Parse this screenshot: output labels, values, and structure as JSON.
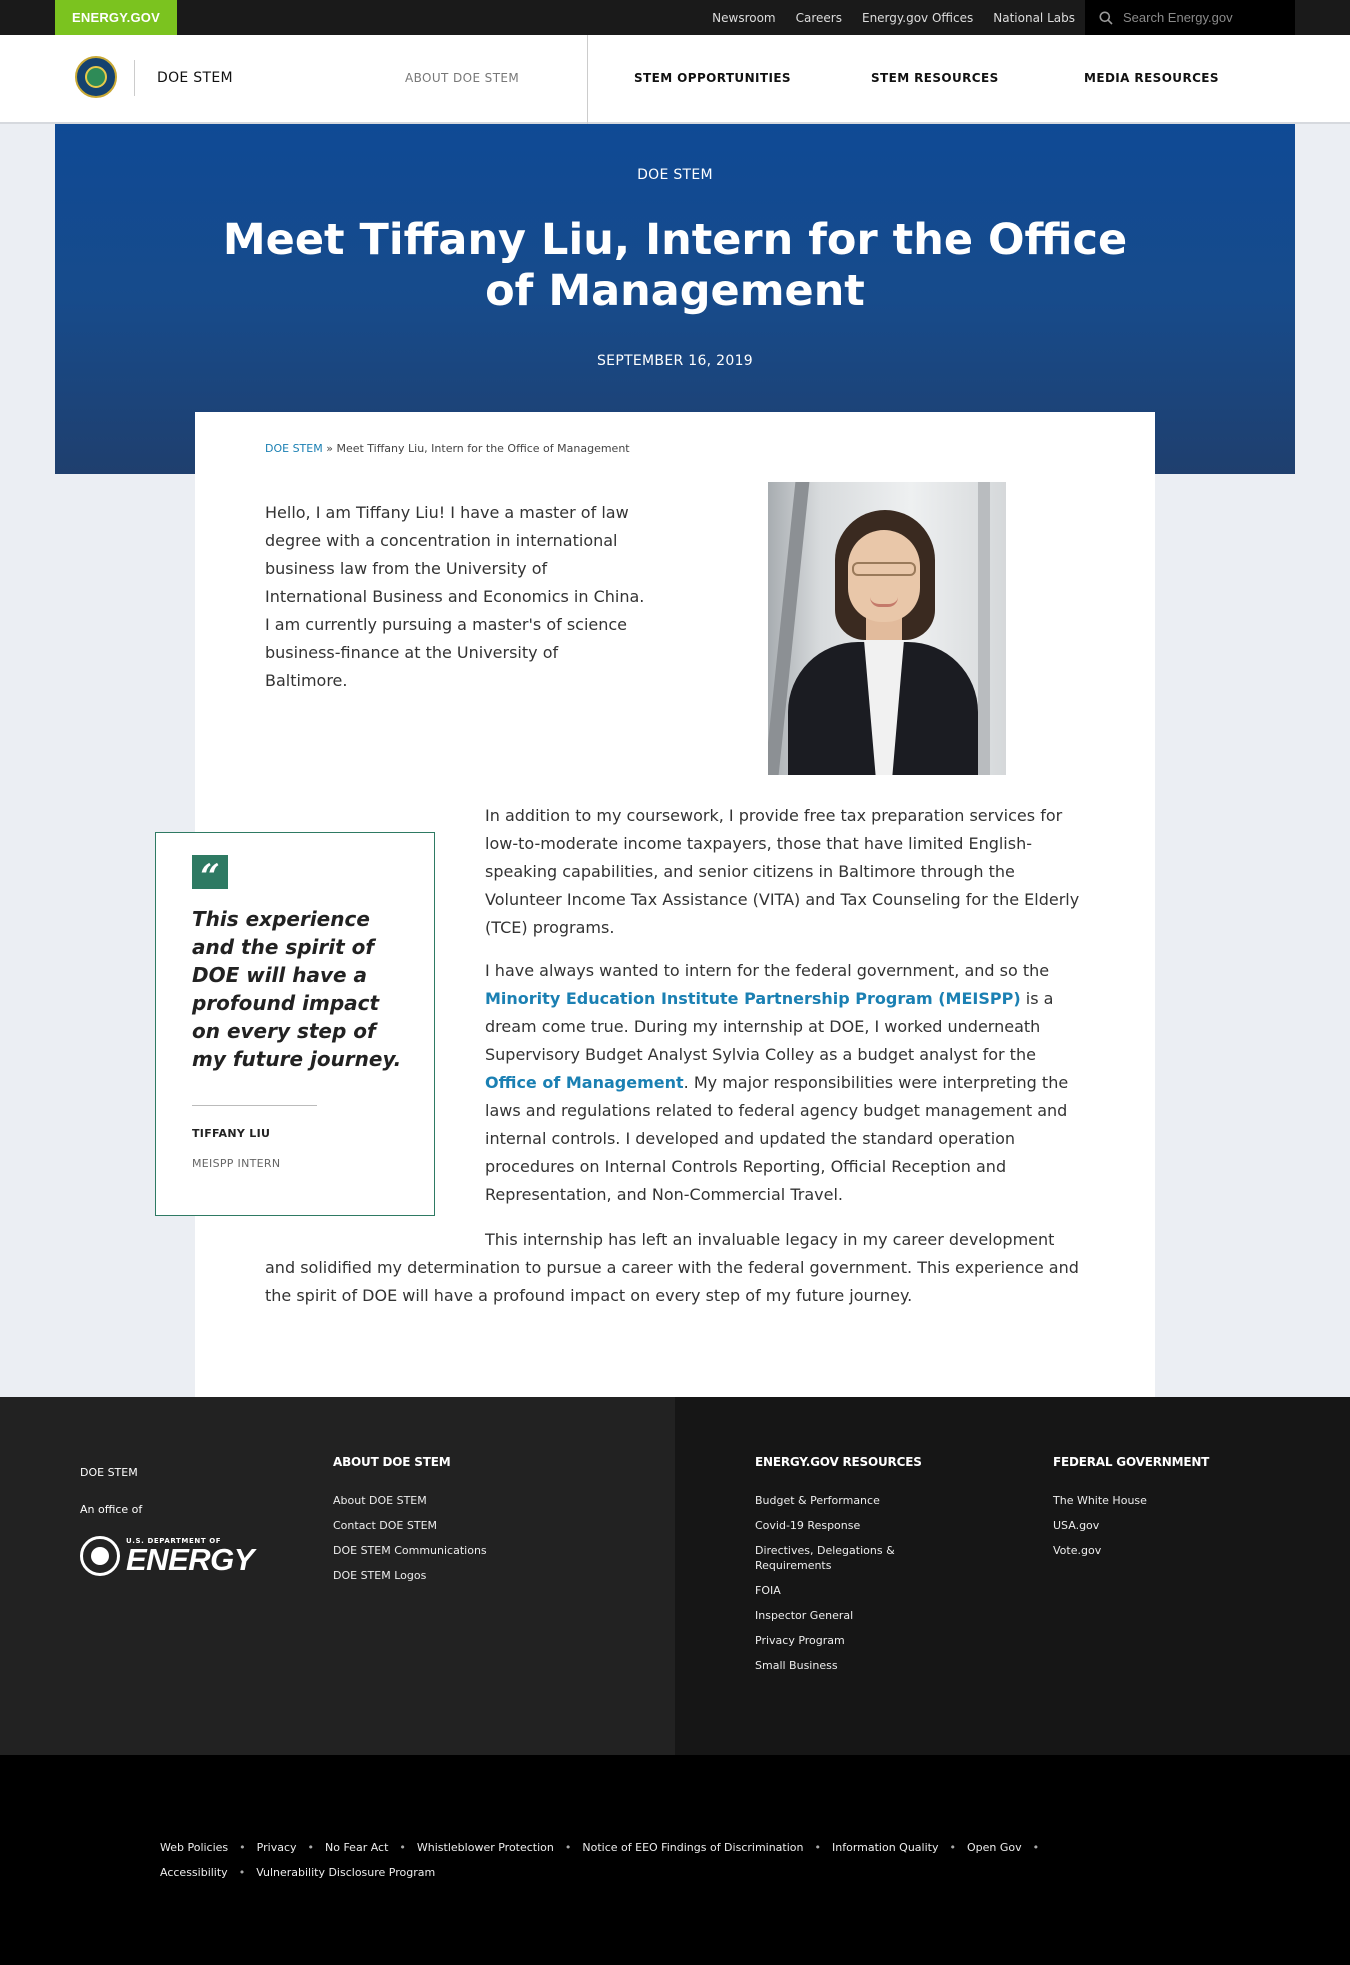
{
  "utility": {
    "brand": "ENERGY.GOV",
    "links": [
      "Newsroom",
      "Careers",
      "Energy.gov Offices",
      "National Labs"
    ],
    "search_placeholder": "Search Energy.gov"
  },
  "nav": {
    "site_name": "DOE STEM",
    "items": [
      "ABOUT DOE STEM",
      "STEM OPPORTUNITIES",
      "STEM RESOURCES",
      "MEDIA RESOURCES"
    ]
  },
  "hero": {
    "kicker": "DOE STEM",
    "title": "Meet Tiffany Liu, Intern for the Office of Management",
    "date": "SEPTEMBER 16, 2019"
  },
  "breadcrumb": {
    "root": "DOE STEM",
    "separator": "»",
    "current": "Meet Tiffany Liu, Intern for the Office of Management"
  },
  "article": {
    "intro": "Hello, I am Tiffany Liu! I have a master of law degree with a concentration in international business law from the University of International Business and Economics in China. I am currently pursuing a master's of science business-finance at the University of Baltimore.",
    "p1": "In addition to my coursework, I provide free tax preparation services for low-to-moderate income taxpayers, those that have limited English-speaking capabilities, and senior citizens in Baltimore through the Volunteer Income Tax Assistance (VITA) and Tax Counseling for the Elderly (TCE) programs.",
    "p2_a": "I have always wanted to intern for the federal government, and so the ",
    "p2_link1": "Minority Education Institute Partnership Program (MEISPP)",
    "p2_b": " is a dream come true. During my internship at DOE, I worked underneath Supervisory Budget Analyst Sylvia Colley as a budget analyst for the ",
    "p2_link2": "Office of Management",
    "p2_c": ". My major responsibilities were interpreting the laws and regulations related to federal agency budget management and internal controls. I developed and updated the standard operation procedures on Internal Controls Reporting, Official Reception and Representation, and Non-Commercial Travel.",
    "p3": "This internship has left an invaluable legacy in my career development and solidified my determination to pursue a career with the federal government. This experience and the spirit of DOE will have a profound impact on every step of my future journey."
  },
  "quote": {
    "mark": "“",
    "text": "This experience and the spirit of DOE will have a profound impact on every step of my future journey.",
    "name": "TIFFANY LIU",
    "role": "MEISPP INTERN"
  },
  "footer": {
    "office": "DOE STEM",
    "office_of": "An office of",
    "logo_small": "U.S. DEPARTMENT OF",
    "logo_big": "ENERGY",
    "col1": {
      "title": "ABOUT DOE STEM",
      "items": [
        "About DOE STEM",
        "Contact DOE STEM",
        "DOE STEM Communications",
        "DOE STEM Logos"
      ]
    },
    "col2": {
      "title": "ENERGY.GOV RESOURCES",
      "items": [
        "Budget & Performance",
        "Covid-19 Response",
        "Directives, Delegations & Requirements",
        "FOIA",
        "Inspector General",
        "Privacy Program",
        "Small Business"
      ]
    },
    "col3": {
      "title": "FEDERAL GOVERNMENT",
      "items": [
        "The White House",
        "USA.gov",
        "Vote.gov"
      ]
    }
  },
  "bottom_links": [
    "Web Policies",
    "Privacy",
    "No Fear Act",
    "Whistleblower Protection",
    "Notice of EEO Findings of Discrimination",
    "Information Quality",
    "Open Gov",
    "Accessibility",
    "Vulnerability Disclosure Program"
  ],
  "colors": {
    "brand_green": "#7bc31f",
    "hero_blue": "#0f4a95",
    "link_blue": "#1b80b3",
    "quote_green": "#2e7a63"
  }
}
